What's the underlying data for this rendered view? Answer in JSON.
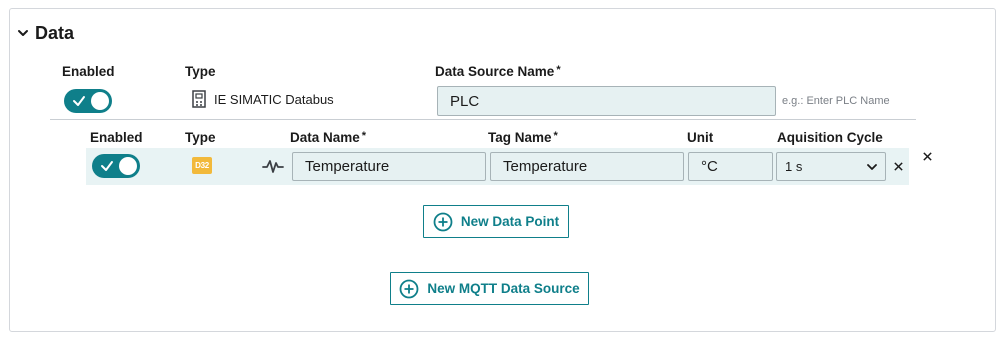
{
  "section": {
    "title": "Data",
    "icon": "chevron-down-icon"
  },
  "data_source": {
    "enabled_label": "Enabled",
    "type_label": "Type",
    "name_label": "Data Source Name",
    "required_mark": "*",
    "enabled": true,
    "type_value": "IE SIMATIC Databus",
    "type_icon": "plc-device-icon",
    "name_value": "PLC",
    "name_placeholder": "e.g.: Enter PLC Name",
    "name_hint": "e.g.: Enter PLC Name"
  },
  "data_point": {
    "headers": {
      "enabled": "Enabled",
      "type": "Type",
      "data_name": "Data Name",
      "tag_name": "Tag Name",
      "unit": "Unit",
      "cycle": "Aquisition Cycle"
    },
    "required_mark": "*",
    "enabled": true,
    "type_badge": "D32",
    "type_icon": "signal-pulse-icon",
    "data_name": "Temperature",
    "tag_name": "Temperature",
    "unit": "°C",
    "cycle": "1 s"
  },
  "buttons": {
    "new_data_point": "New Data Point",
    "new_mqtt_source": "New MQTT Data Source"
  },
  "colors": {
    "accent": "#0f7f8a",
    "input_bg": "#e6f1f2",
    "badge": "#f2b93b"
  }
}
